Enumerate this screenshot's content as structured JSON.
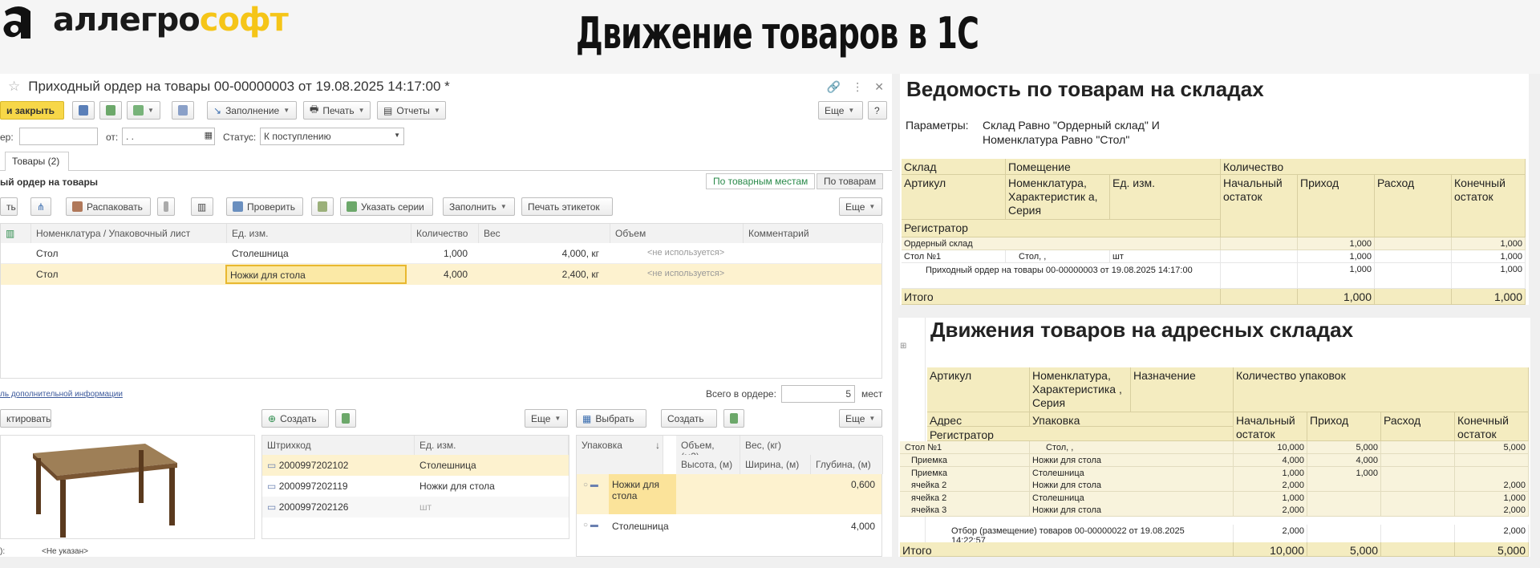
{
  "header": {
    "logo_a": "аллегро",
    "logo_b": "софт",
    "title": "Движение товаров в 1С"
  },
  "form": {
    "title": "Приходный ордер на товары 00-00000003 от 19.08.2025 14:17:00 *",
    "post_close": "и закрыть",
    "fill": "Заполнение",
    "print": "Печать",
    "reports": "Отчеты",
    "more": "Еще",
    "help": "?",
    "number_label": "ер:",
    "from_label": "от:",
    "date_value": " .  .",
    "status_label": "Статус:",
    "status_value": "К поступлению",
    "tab_goods": "Товары (2)",
    "section_title": "ый ордер на товары",
    "seg_places": "По товарным местам",
    "seg_goods": "По товарам",
    "btn_tb0": "ть",
    "btn_unpack": "Распаковать",
    "btn_check": "Проверить",
    "btn_series": "Указать серии",
    "btn_fill": "Заполнить",
    "btn_labels": "Печать этикеток",
    "columns": [
      "Номенклатура / Упаковочный лист",
      "Ед. изм.",
      "Количество",
      "Вес",
      "Объем",
      "Комментарий"
    ],
    "rows": [
      {
        "name": "Стол",
        "unit": "Столешница",
        "qty": "1,000",
        "weight": "4,000, кг",
        "volume": "<не используется>"
      },
      {
        "name": "Стол",
        "unit": "Ножки для стола",
        "qty": "4,000",
        "weight": "2,400, кг",
        "volume": "<не используется>"
      }
    ],
    "extra_info_link": "ль дополнительной информации",
    "total_label": "Всего в ордере:",
    "total_value": "5",
    "total_unit": "мест",
    "btn_edit": "ктировать",
    "btn_create": "Создать",
    "btn_select": "Выбрать",
    "btn_create2": "Создать",
    "bc_columns": [
      "Штрихкод",
      "Ед. изм."
    ],
    "barcodes": [
      {
        "code": "2000997202102",
        "unit": "Столешница"
      },
      {
        "code": "2000997202119",
        "unit": "Ножки для стола"
      },
      {
        "code": "2000997202126",
        "unit": "шт"
      }
    ],
    "pk_columns": [
      "Упаковка",
      "↓",
      "Объем, (м3)",
      "Вес, (кг)",
      "Высота, (м)",
      "Ширина, (м)",
      "Глубина, (м)"
    ],
    "packages": [
      {
        "name": "Ножки для стола",
        "depth": "0,600"
      },
      {
        "name": "Столешница",
        "depth": "4,000"
      }
    ],
    "bottom_label": "):",
    "bottom_value": "<Не указан>"
  },
  "report1": {
    "title": "Ведомость по товарам на складах",
    "params_label": "Параметры:",
    "params_line1": "Склад Равно \"Ордерный склад\" И",
    "params_line2": "Номенклатура Равно \"Стол\"",
    "h_sklad": "Склад",
    "h_room": "Помещение",
    "h_qty": "Количество",
    "h_art": "Артикул",
    "h_nom": "Номенклатура, Характеристик а, Серия",
    "h_unit": "Ед. изм.",
    "h_start": "Начальный остаток",
    "h_in": "Приход",
    "h_out": "Расход",
    "h_end": "Конечный остаток",
    "h_reg": "Регистратор",
    "rows": [
      {
        "a": "Ордерный склад",
        "b": "",
        "c": "",
        "in": "1,000",
        "end": "1,000"
      },
      {
        "a": "Стол №1",
        "b": "Стол, ,",
        "c": "шт",
        "in": "1,000",
        "end": "1,000"
      },
      {
        "a": "Приходный ордер на товары 00-00000003 от 19.08.2025 14:17:00",
        "b": "",
        "c": "",
        "in": "1,000",
        "end": "1,000"
      }
    ],
    "total_label": "Итого",
    "total_in": "1,000",
    "total_end": "1,000"
  },
  "report2": {
    "title": "Движения товаров на адресных складах",
    "h_art": "Артикул",
    "h_nom": "Номенклатура, Характеристика , Серия",
    "h_dest": "Назначение",
    "h_qty": "Количество упаковок",
    "h_addr": "Адрес",
    "h_pack": "Упаковка",
    "h_reg": "Регистратор",
    "h_start": "Начальный остаток",
    "h_in": "Приход",
    "h_out": "Расход",
    "h_end": "Конечный остаток",
    "rows": [
      {
        "a": "Стол №1",
        "b": "Стол, ,",
        "start": "10,000",
        "out": "5,000",
        "end": "5,000",
        "lvl": 0
      },
      {
        "a": "Приемка",
        "b": "Ножки для стола",
        "start": "4,000",
        "out": "4,000",
        "end": "",
        "lvl": 1
      },
      {
        "a": "Приемка",
        "b": "Столешница",
        "start": "1,000",
        "out": "1,000",
        "end": "",
        "lvl": 1
      },
      {
        "a": "ячейка 2",
        "b": "Ножки для стола",
        "start": "2,000",
        "out": "",
        "end": "2,000",
        "lvl": 1
      },
      {
        "a": "ячейка 2",
        "b": "Столешница",
        "start": "1,000",
        "out": "",
        "end": "1,000",
        "lvl": 1
      },
      {
        "a": "ячейка 3",
        "b": "Ножки для стола",
        "start": "2,000",
        "out": "",
        "end": "2,000",
        "lvl": 1
      }
    ],
    "reg_line1": "Отбор (размещение) товаров 00-00000022 от 19.08.2025",
    "reg_line2": "14:22:57",
    "reg_start": "2,000",
    "reg_end": "2,000",
    "total_label": "Итого",
    "total_start": "10,000",
    "total_out": "5,000",
    "total_end": "5,000"
  },
  "colors": {
    "accent_yellow": "#f7d748",
    "report_header": "#f4ecc0",
    "selected_row": "#fdf2cf"
  }
}
